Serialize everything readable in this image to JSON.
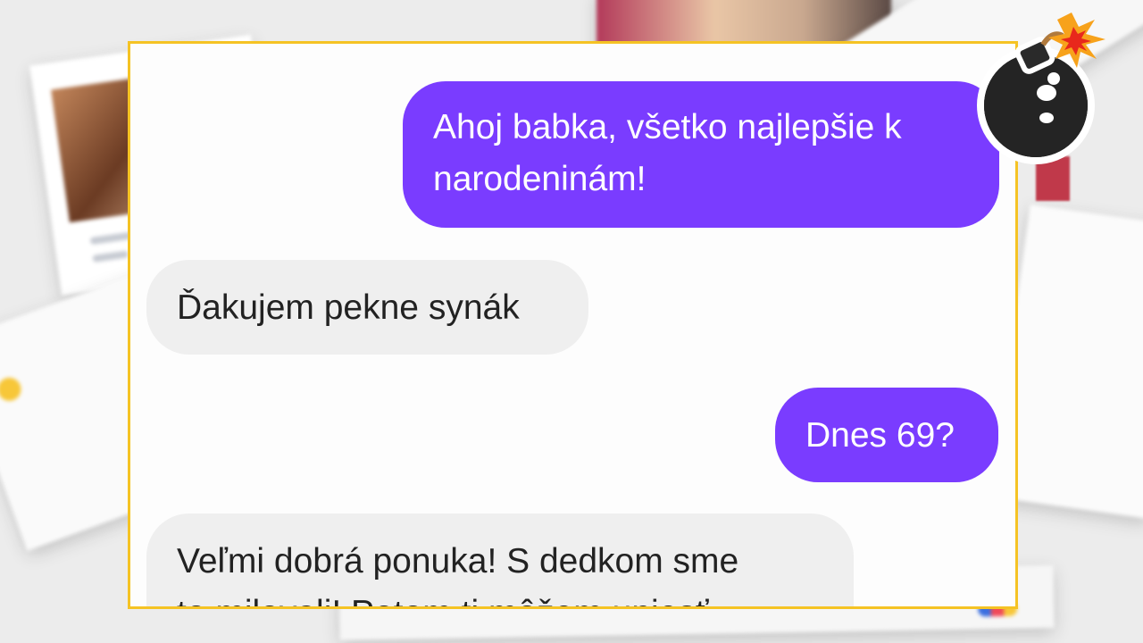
{
  "colors": {
    "outgoing_bubble": "#7a3cff",
    "incoming_bubble": "#efefef",
    "frame_border": "#f5c324"
  },
  "chat": {
    "messages": [
      {
        "direction": "outgoing",
        "text": "Ahoj babka, všetko najlepšie k\nnarodeninám!"
      },
      {
        "direction": "incoming",
        "text": "Ďakujem pekne synák"
      },
      {
        "direction": "outgoing",
        "text": "Dnes 69?"
      },
      {
        "direction": "incoming",
        "text": "Veľmi dobrá ponuka! S dedkom sme\nto milovali! Potom ti môžem uniesť"
      }
    ]
  },
  "decoration": {
    "icon": "bomb-icon"
  }
}
